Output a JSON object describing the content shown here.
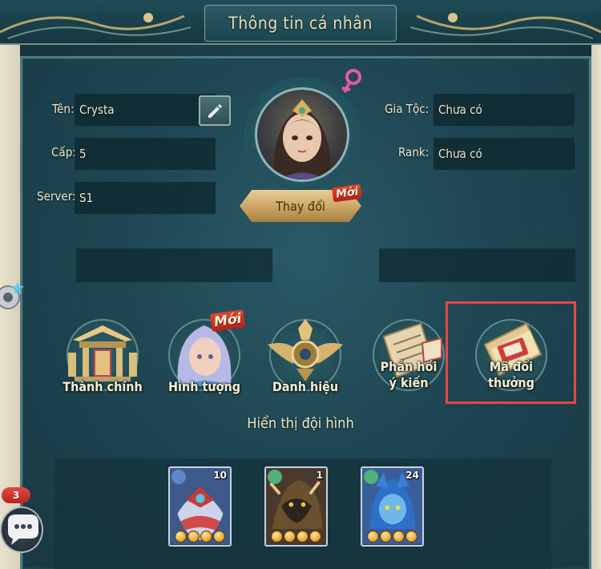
{
  "header": {
    "title": "Thông tin cá nhân"
  },
  "profile": {
    "name_label": "Tên:",
    "name_value": "Crysta",
    "level_label": "Cấp:",
    "level_value": "5",
    "server_label": "Server:",
    "server_value": "S1",
    "guild_label": "Gia Tộc:",
    "guild_value": "Chưa có",
    "rank_label": "Rank:",
    "rank_value": "Chưa có",
    "gender_icon": "female-symbol-icon",
    "change_button_label": "Thay đổi",
    "new_badge": "Mới"
  },
  "features": [
    {
      "label": "Thành chính",
      "icon": "palace-icon"
    },
    {
      "label": "Hình tượng",
      "icon": "character-portrait-icon",
      "badge": "Mới"
    },
    {
      "label": "Danh hiệu",
      "icon": "winged-emblem-icon"
    },
    {
      "label_line1": "Phản hồi",
      "label_line2": "ý kiến",
      "icon": "feedback-scroll-icon"
    },
    {
      "label_line1": "Mã đổi",
      "label_line2": "thưởng",
      "icon": "gift-code-ticket-icon"
    }
  ],
  "lineup": {
    "title": "Hiển thị đội hình",
    "heroes": [
      {
        "level": "10",
        "element_color": "#5b86c8",
        "stars": 4
      },
      {
        "level": "1",
        "element_color": "#4fb07a",
        "stars": 4
      },
      {
        "level": "24",
        "element_color": "#4fb07a",
        "stars": 4
      }
    ]
  },
  "chat": {
    "badge_count": "3"
  },
  "colors": {
    "highlight": "#e1474b",
    "accent_gold": "#c9a463",
    "panel_bg": "#1f4753"
  }
}
